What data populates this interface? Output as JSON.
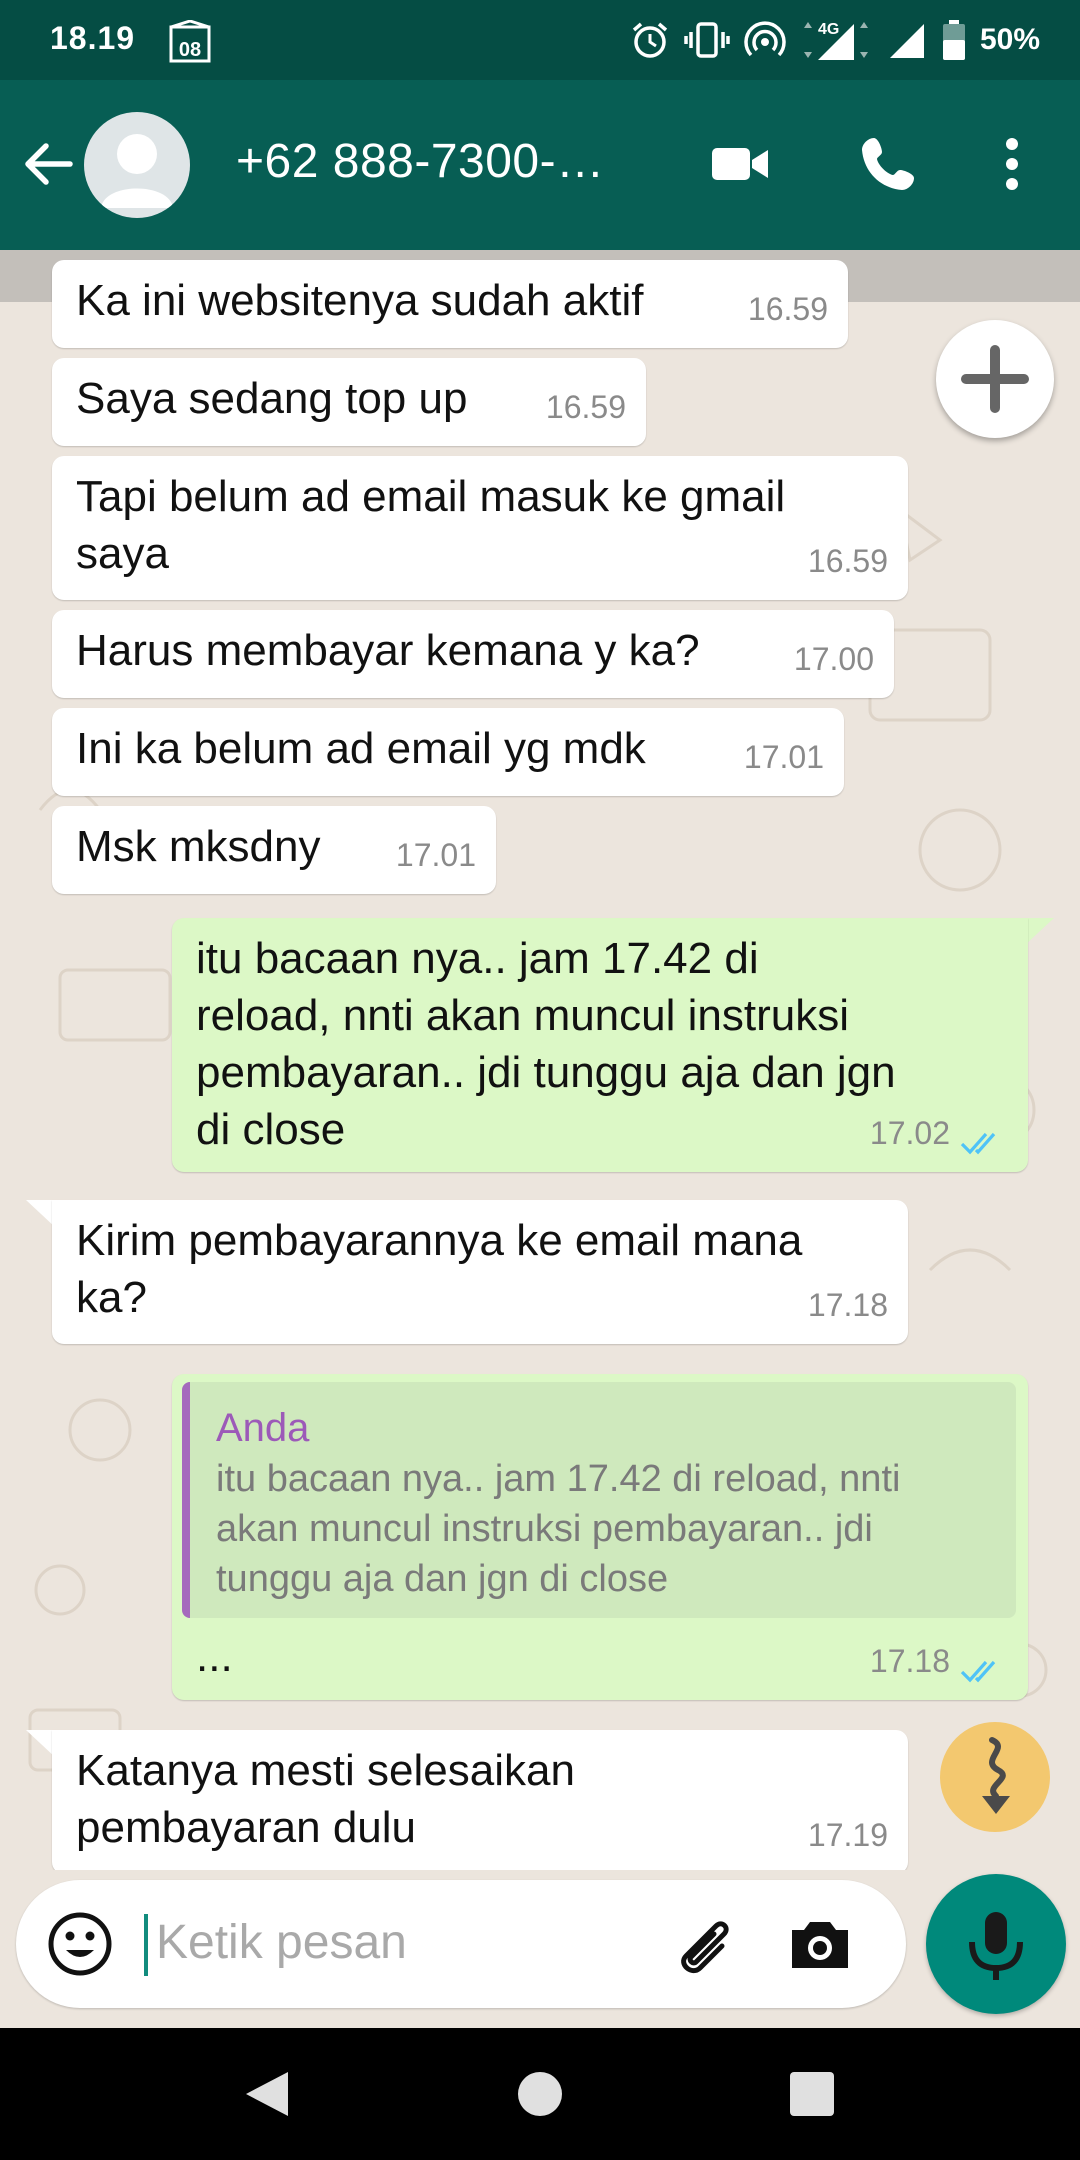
{
  "status_bar": {
    "time": "18.19",
    "calendar_day": "08",
    "network": "4G",
    "battery": "50%"
  },
  "header": {
    "contact": "+62 888-7300-…"
  },
  "messages": [
    {
      "dir": "in",
      "text": "Ka ini websitenya sudah aktif",
      "time": "16.59"
    },
    {
      "dir": "in",
      "text": "Saya sedang top up",
      "time": "16.59"
    },
    {
      "dir": "in",
      "text": "Tapi belum ad email masuk ke gmail\nsaya",
      "time": "16.59"
    },
    {
      "dir": "in",
      "text": "Harus membayar kemana y ka?",
      "time": "17.00"
    },
    {
      "dir": "in",
      "text": "Ini ka belum ad email yg mdk",
      "time": "17.01"
    },
    {
      "dir": "in",
      "text": "Msk mksdny",
      "time": "17.01"
    },
    {
      "dir": "out",
      "text": "itu bacaan nya.. jam 17.42 di\nreload, nnti akan muncul instruksi\npembayaran.. jdi tunggu aja dan jgn\ndi close",
      "time": "17.02",
      "read": true
    },
    {
      "dir": "in",
      "text": "Kirim pembayarannya ke email mana\nka?",
      "time": "17.18"
    },
    {
      "dir": "out",
      "text": "...",
      "time": "17.18",
      "read": true,
      "quote": {
        "author": "Anda",
        "text": "itu bacaan nya.. jam 17.42 di reload, nnti\nakan muncul instruksi pembayaran.. jdi\ntunggu aja dan jgn di close"
      }
    },
    {
      "dir": "in",
      "text": "Katanya mesti selesaikan\npembayaran dulu",
      "time": "17.19"
    }
  ],
  "input": {
    "placeholder": "Ketik pesan"
  },
  "icons": {
    "back": "arrow-left",
    "video": "video-camera",
    "call": "phone",
    "menu": "more-vertical",
    "add": "plus",
    "scroll": "scroll-down",
    "emoji": "smiley",
    "attach": "paperclip",
    "camera": "camera",
    "mic": "microphone"
  },
  "colors": {
    "header": "#075e54",
    "status_bar": "#054d44",
    "incoming": "#ffffff",
    "outgoing": "#dcf8c6",
    "read_ticks": "#4fc3f7",
    "mic_button": "#00897b"
  }
}
